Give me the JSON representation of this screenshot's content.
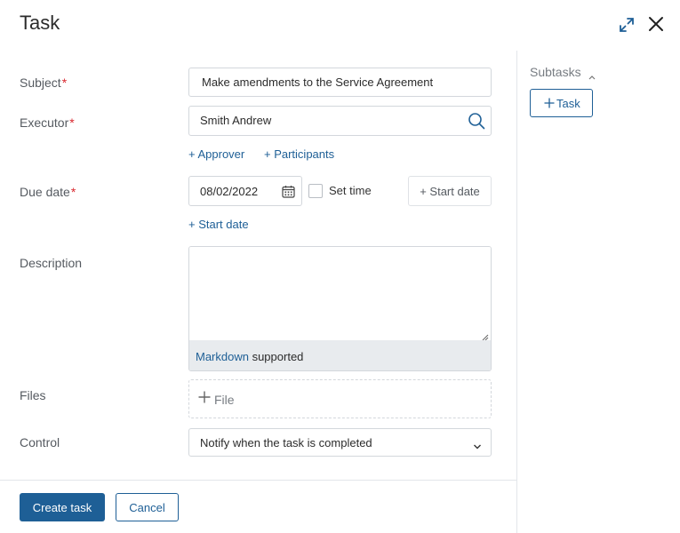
{
  "dialog": {
    "title": "Task"
  },
  "form": {
    "subject": {
      "label": "Subject",
      "required_mark": "*",
      "value": "Make amendments to the Service Agreement"
    },
    "executor": {
      "label": "Executor",
      "required_mark": "*",
      "value": "Smith Andrew"
    },
    "executor_links": {
      "approver": "+ Approver",
      "participants": "+ Participants"
    },
    "due_date": {
      "label": "Due date",
      "required_mark": "*",
      "value": "08/02/2022",
      "set_time_label": "Set time",
      "set_time_checked": false,
      "start_date_button": "+ Start date",
      "start_date_link": "+ Start date"
    },
    "description": {
      "label": "Description",
      "value": "",
      "markdown_link": "Markdown",
      "markdown_suffix": " supported"
    },
    "files": {
      "label": "Files",
      "add_label": "File"
    },
    "control": {
      "label": "Control",
      "selected": "Notify when the task is completed"
    }
  },
  "footer": {
    "create_label": "Create task",
    "cancel_label": "Cancel"
  },
  "sidebar": {
    "subtasks_label": "Subtasks",
    "add_task_label": "Task"
  },
  "icons": {
    "expand": "expand-icon",
    "close": "close-icon",
    "search": "search-icon",
    "calendar": "calendar-icon",
    "plus": "plus-icon",
    "chevron_down": "chevron-down-icon",
    "chevron_up": "chevron-up-icon"
  },
  "colors": {
    "primary": "#1e5f96",
    "required": "#d9272e",
    "markdown_bar": "#e8ebee"
  }
}
